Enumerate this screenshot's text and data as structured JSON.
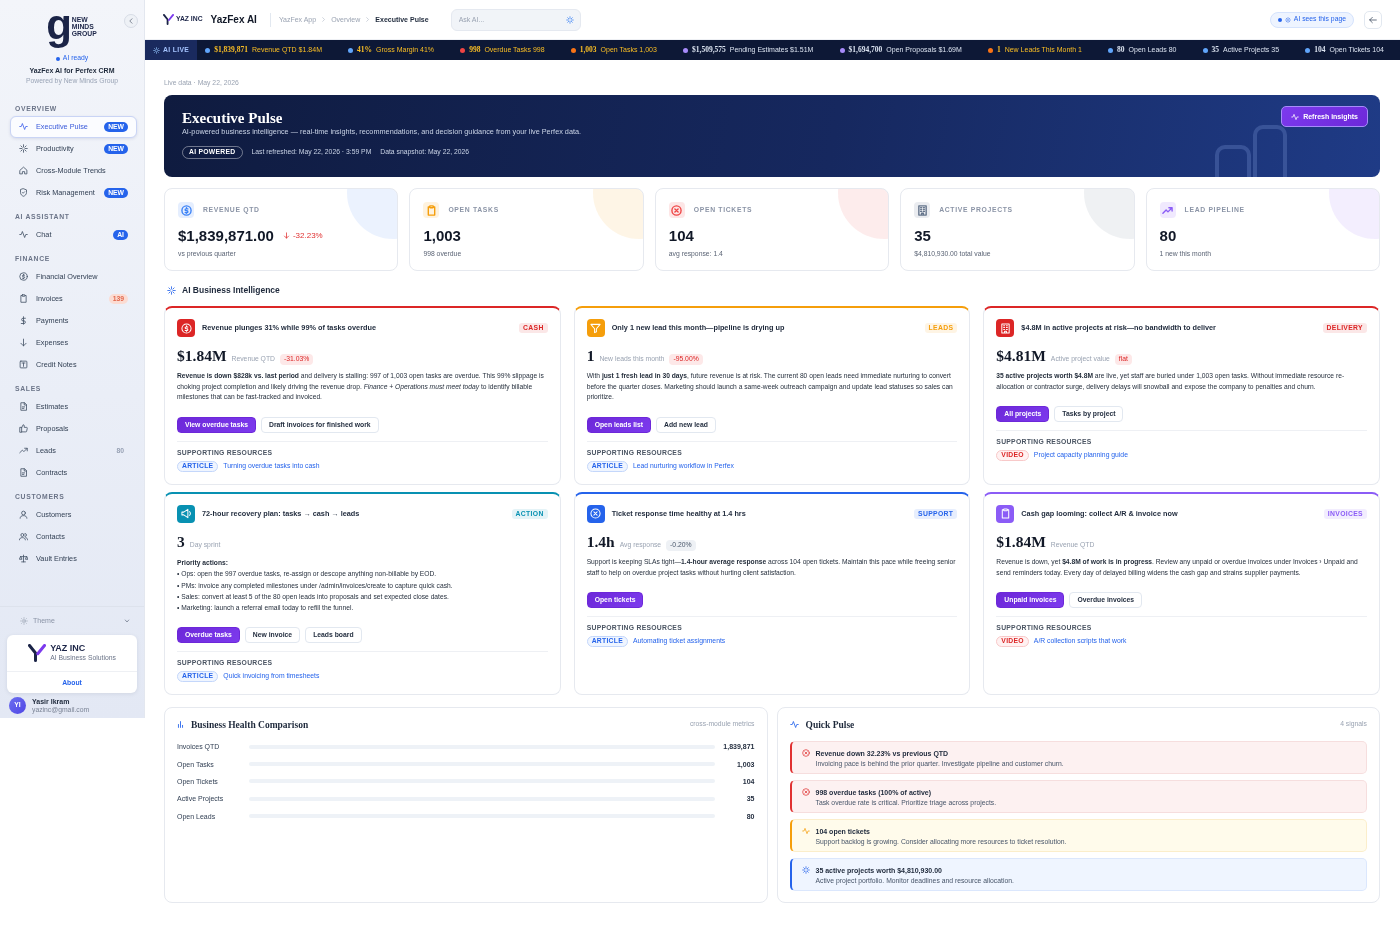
{
  "sidebar": {
    "logo": {
      "letter": "g",
      "text": "NEW MINDS GROUP"
    },
    "status": "AI ready",
    "app_name": "YazFex AI for Perfex CRM",
    "powered_by": "Powered by New Minds Group",
    "sections": [
      {
        "title": "OVERVIEW",
        "items": [
          {
            "label": "Executive Pulse",
            "selected": true,
            "badge": {
              "text": "NEW",
              "kind": "new"
            }
          },
          {
            "label": "Productivity",
            "selected": false,
            "badge": {
              "text": "NEW",
              "kind": "new"
            }
          },
          {
            "label": "Cross-Module Trends",
            "selected": false
          },
          {
            "label": "Risk Management",
            "selected": false,
            "badge": {
              "text": "NEW",
              "kind": "new"
            }
          }
        ]
      },
      {
        "title": "AI ASSISTANT",
        "items": [
          {
            "label": "Chat",
            "selected": false,
            "badge": {
              "text": "AI",
              "kind": "new"
            }
          }
        ]
      },
      {
        "title": "FINANCE",
        "items": [
          {
            "label": "Financial Overview",
            "selected": false
          },
          {
            "label": "Invoices",
            "selected": false,
            "badge": {
              "text": "139",
              "kind": "alert"
            }
          },
          {
            "label": "Payments",
            "selected": false
          },
          {
            "label": "Expenses",
            "selected": false
          },
          {
            "label": "Credit Notes",
            "selected": false
          }
        ]
      },
      {
        "title": "SALES",
        "items": [
          {
            "label": "Estimates",
            "selected": false
          },
          {
            "label": "Proposals",
            "selected": false
          },
          {
            "label": "Leads",
            "selected": false,
            "badge": {
              "text": "80",
              "kind": "muted"
            }
          },
          {
            "label": "Contracts",
            "selected": false
          }
        ]
      },
      {
        "title": "CUSTOMERS",
        "items": [
          {
            "label": "Customers",
            "selected": false
          },
          {
            "label": "Contacts",
            "selected": false
          },
          {
            "label": "Vault Entries",
            "selected": false
          }
        ]
      }
    ],
    "theme": "Theme",
    "brand_card": {
      "name": "YAZ INC",
      "tagline": "AI Business Solutions",
      "link": "About"
    },
    "user": {
      "initials": "YI",
      "name": "Yasir Ikram",
      "email": "yazinc@gmail.com"
    }
  },
  "topbar": {
    "logo_text": "YAZ INC",
    "app_name": "YazFex AI",
    "breadcrumb": [
      {
        "label": "YazFex App",
        "current": false
      },
      {
        "label": "Overview",
        "current": false
      },
      {
        "label": "Executive Pulse",
        "current": true
      }
    ],
    "search": {
      "placeholder": "Ask AI..."
    },
    "context_pill": "AI sees this page"
  },
  "ticker": {
    "label": "AI LIVE",
    "items": [
      {
        "value": "$1,839,871",
        "label": "Revenue QTD $1.84M",
        "color": "#60a5fa",
        "kind": "highlight"
      },
      {
        "value": "41%",
        "label": "Gross Margin 41%",
        "color": "#60a5fa",
        "kind": "highlight"
      },
      {
        "value": "998",
        "label": "Overdue Tasks 998",
        "color": "#ef4444",
        "kind": "highlight"
      },
      {
        "value": "1,003",
        "label": "Open Tasks 1,003",
        "color": "#f97316",
        "kind": "highlight"
      },
      {
        "value": "$1,509,575",
        "label": "Pending Estimates $1.51M",
        "color": "#a78bfa",
        "kind": "normal"
      },
      {
        "value": "$1,694,700",
        "label": "Open Proposals $1.69M",
        "color": "#a78bfa",
        "kind": "normal"
      },
      {
        "value": "1",
        "label": "New Leads This Month 1",
        "color": "#f97316",
        "kind": "highlight"
      },
      {
        "value": "80",
        "label": "Open Leads 80",
        "color": "#60a5fa",
        "kind": "normal"
      },
      {
        "value": "35",
        "label": "Active Projects 35",
        "color": "#60a5fa",
        "kind": "normal"
      },
      {
        "value": "104",
        "label": "Open Tickets 104",
        "color": "#60a5fa",
        "kind": "normal"
      }
    ]
  },
  "meta": "Live data · May 22, 2026",
  "hero": {
    "title": "Executive Pulse",
    "subtitle": "AI-powered business intelligence — real-time insights, recommendations, and decision guidance from your live Perfex data.",
    "badge": "AI POWERED",
    "refreshed": "Last refreshed: May 22, 2026 · 3:59 PM",
    "snapshot": "Data snapshot: May 22, 2026",
    "button": "Refresh insights"
  },
  "stats": [
    {
      "label": "REVENUE QTD",
      "value": "$1,839,871.00",
      "change": "-32.23%",
      "note": "vs previous quarter",
      "color": "#3b82f6"
    },
    {
      "label": "OPEN TASKS",
      "value": "1,003",
      "note": "998 overdue",
      "color": "#f59e0b"
    },
    {
      "label": "OPEN TICKETS",
      "value": "104",
      "note": "avg response: 1.4",
      "color": "#ef4444"
    },
    {
      "label": "ACTIVE PROJECTS",
      "value": "35",
      "note": "$4,810,930.00 total value",
      "color": "#64748b"
    },
    {
      "label": "LEAD PIPELINE",
      "value": "80",
      "note": "1 new this month",
      "color": "#8b5cf6"
    }
  ],
  "insights_title": "AI Business Intelligence",
  "insights": [
    {
      "title": "Revenue plunges 31% while 99% of tasks overdue",
      "tag": "CASH",
      "color": "#dc2626",
      "metric": {
        "value": "$1.84M",
        "label": "Revenue QTD",
        "delta": "-31.03%",
        "negative": true
      },
      "body": "**Revenue is down $828k vs. last period** and delivery is stalling: 997 of 1,003 open tasks are overdue. This 99% slippage is choking project completion and likely driving the revenue drop. *Finance + Operations must meet today* to identify billable milestones that can be fast-tracked and invoiced.",
      "buttons": [
        {
          "label": "View overdue tasks",
          "primary": true
        },
        {
          "label": "Draft invoices for finished work",
          "primary": false
        }
      ],
      "resources_title": "SUPPORTING RESOURCES",
      "resources": [
        {
          "type": "ARTICLE",
          "kind": "article",
          "title": "Turning overdue tasks into cash"
        }
      ]
    },
    {
      "title": "Only 1 new lead this month—pipeline is drying up",
      "tag": "LEADS",
      "color": "#f59e0b",
      "metric": {
        "value": "1",
        "label": "New leads this month",
        "delta": "-95.00%",
        "negative": true
      },
      "body": "With **just 1 fresh lead in 30 days**, future revenue is at risk. The current 80 open leads need immediate nurturing to convert before the quarter closes. Marketing should launch a same-week outreach campaign and update lead statuses so sales can prioritize.",
      "buttons": [
        {
          "label": "Open leads list",
          "primary": true
        },
        {
          "label": "Add new lead",
          "primary": false
        }
      ],
      "resources_title": "SUPPORTING RESOURCES",
      "resources": [
        {
          "type": "ARTICLE",
          "kind": "article",
          "title": "Lead nurturing workflow in Perfex"
        }
      ]
    },
    {
      "title": "$4.8M in active projects at risk—no bandwidth to deliver",
      "tag": "DELIVERY",
      "color": "#dc2626",
      "metric": {
        "value": "$4.81M",
        "label": "Active project value",
        "delta": "flat",
        "negative": true
      },
      "body": "**35 active projects worth $4.8M** are live, yet staff are buried under 1,003 open tasks. Without immediate resource re-allocation or contractor surge, delivery delays will snowball and expose the company to penalties and churn.",
      "buttons": [
        {
          "label": "All projects",
          "primary": true
        },
        {
          "label": "Tasks by project",
          "primary": false
        }
      ],
      "resources_title": "SUPPORTING RESOURCES",
      "resources": [
        {
          "type": "VIDEO",
          "kind": "video",
          "title": "Project capacity planning guide"
        }
      ]
    },
    {
      "title": "72-hour recovery plan: tasks → cash → leads",
      "tag": "ACTION",
      "color": "#0891b2",
      "metric": {
        "value": "3",
        "label": "Day sprint"
      },
      "actions": {
        "title": "Priority actions:",
        "items": [
          "• Ops: open the 997 overdue tasks, re-assign or descope anything non-billable by EOD.",
          "• PMs: invoice any completed milestones under /admin/invoices/create to capture quick cash.",
          "• Sales: convert at least 5 of the 80 open leads into proposals and set expected close dates.",
          "• Marketing: launch a referral email today to refill the funnel."
        ]
      },
      "buttons": [
        {
          "label": "Overdue tasks",
          "primary": true
        },
        {
          "label": "New invoice",
          "primary": false
        },
        {
          "label": "Leads board",
          "primary": false
        }
      ],
      "resources_title": "SUPPORTING RESOURCES",
      "resources": [
        {
          "type": "ARTICLE",
          "kind": "article",
          "title": "Quick invoicing from timesheets"
        }
      ]
    },
    {
      "title": "Ticket response time healthy at 1.4 hrs",
      "tag": "SUPPORT",
      "color": "#2563eb",
      "metric": {
        "value": "1.4h",
        "label": "Avg response",
        "delta": "-0.20%",
        "negative": false
      },
      "body": "Support is keeping SLAs tight—**1.4-hour average response** across 104 open tickets. Maintain this pace while freeing senior staff to help on overdue project tasks without hurting client satisfaction.",
      "buttons": [
        {
          "label": "Open tickets",
          "primary": true
        }
      ],
      "resources_title": "SUPPORTING RESOURCES",
      "resources": [
        {
          "type": "ARTICLE",
          "kind": "article",
          "title": "Automating ticket assignments"
        }
      ]
    },
    {
      "title": "Cash gap looming: collect A/R & invoice now",
      "tag": "INVOICES",
      "color": "#8b5cf6",
      "metric": {
        "value": "$1.84M",
        "label": "Revenue QTD"
      },
      "body": "Revenue is down, yet **$4.8M of work is in progress**. Review any unpaid or overdue invoices under Invoices › Unpaid and send reminders today. Every day of delayed billing widens the cash gap and strains supplier payments.",
      "buttons": [
        {
          "label": "Unpaid invoices",
          "primary": true
        },
        {
          "label": "Overdue invoices",
          "primary": false
        }
      ],
      "resources_title": "SUPPORTING RESOURCES",
      "resources": [
        {
          "type": "VIDEO",
          "kind": "video",
          "title": "A/R collection scripts that work"
        }
      ]
    }
  ],
  "comparison": {
    "title": "Business Health Comparison",
    "caption": "cross-module metrics",
    "rows": [
      {
        "label": "Invoices QTD",
        "value": "1,839,871"
      },
      {
        "label": "Open Tasks",
        "value": "1,003"
      },
      {
        "label": "Open Tickets",
        "value": "104"
      },
      {
        "label": "Active Projects",
        "value": "35"
      },
      {
        "label": "Open Leads",
        "value": "80"
      }
    ]
  },
  "quick_pulse": {
    "title": "Quick Pulse",
    "caption": "4 signals",
    "signals": [
      {
        "kind": "danger",
        "title": "Revenue down 32.23% vs previous QTD",
        "text": "Invoicing pace is behind the prior quarter. Investigate pipeline and customer churn."
      },
      {
        "kind": "danger",
        "title": "998 overdue tasks (100% of active)",
        "text": "Task overdue rate is critical. Prioritize triage across projects."
      },
      {
        "kind": "warning",
        "title": "104 open tickets",
        "text": "Support backlog is growing. Consider allocating more resources to ticket resolution."
      },
      {
        "kind": "info",
        "title": "35 active projects worth $4,810,930.00",
        "text": "Active project portfolio. Monitor deadlines and resource allocation."
      }
    ]
  }
}
